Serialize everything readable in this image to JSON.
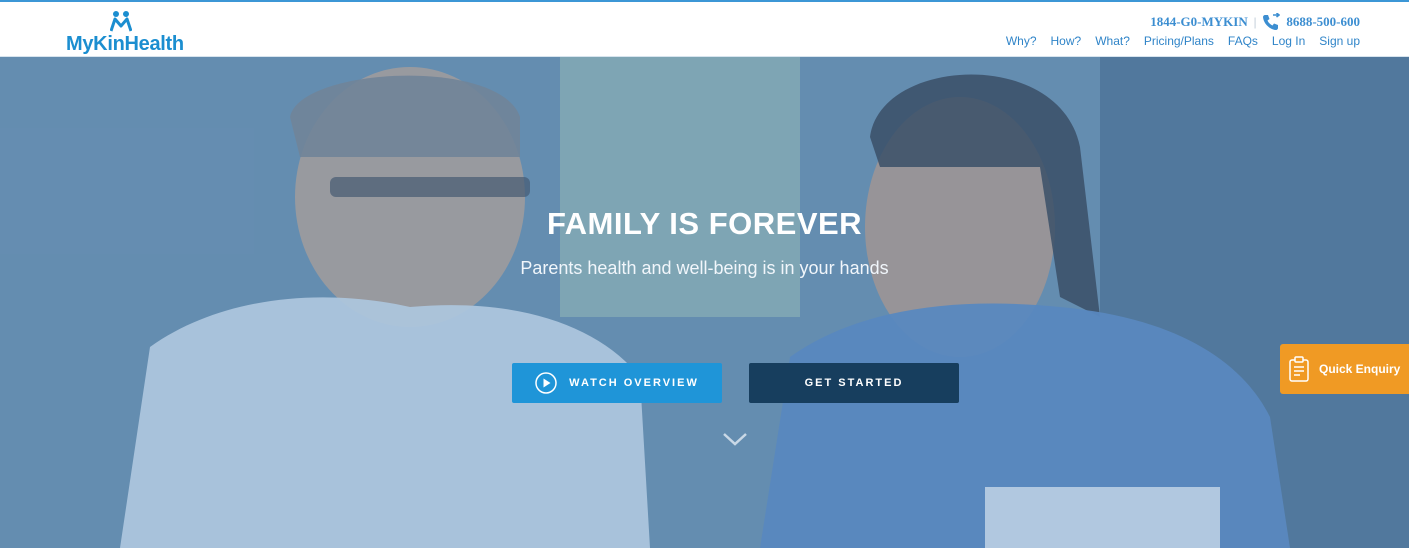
{
  "brand": {
    "name": "MyKinHealth",
    "color": "#1b8ed0"
  },
  "contact": {
    "primary": "1844-G0-MYKIN",
    "separator": "|",
    "phone": "8688-500-600",
    "phone_icon": "phone-forward-icon"
  },
  "nav": {
    "items": [
      {
        "label": "Why?"
      },
      {
        "label": "How?"
      },
      {
        "label": "What?"
      },
      {
        "label": "Pricing/Plans"
      },
      {
        "label": "FAQs"
      },
      {
        "label": "Log In"
      },
      {
        "label": "Sign up"
      }
    ]
  },
  "hero": {
    "title": "FAMILY IS FOREVER",
    "subtitle": "Parents health and well-being is in your hands",
    "watch_label": "WATCH OVERVIEW",
    "watch_icon": "play-circle-icon",
    "start_label": "GET STARTED",
    "scroll_icon": "chevron-down-icon"
  },
  "quick_enquiry": {
    "label": "Quick Enquiry",
    "icon": "clipboard-icon",
    "color": "#f09a24"
  },
  "colors": {
    "accent": "#1f95d8",
    "dark_button": "#173e5e",
    "nav_text": "#2f84c8"
  }
}
